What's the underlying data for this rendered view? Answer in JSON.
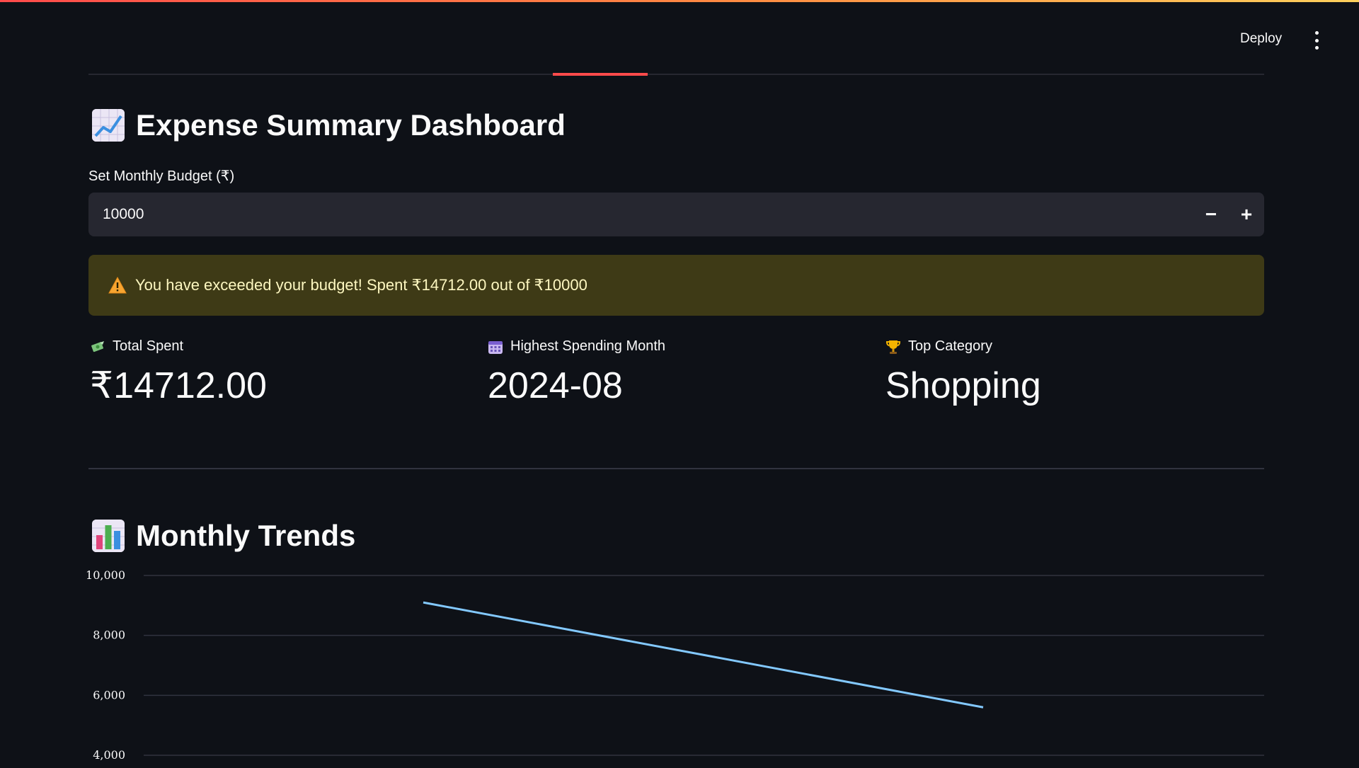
{
  "header": {
    "deploy_label": "Deploy"
  },
  "dashboard": {
    "title": "Expense Summary Dashboard",
    "budget_label": "Set Monthly Budget (₹)",
    "budget_value": "10000",
    "decrement_label": "−",
    "increment_label": "+",
    "alert_text": "You have exceeded your budget! Spent ₹14712.00 out of ₹10000",
    "metrics": [
      {
        "label": "Total Spent",
        "value": "₹14712.00",
        "icon": "money-icon"
      },
      {
        "label": "Highest Spending Month",
        "value": "2024-08",
        "icon": "calendar-icon"
      },
      {
        "label": "Top Category",
        "value": "Shopping",
        "icon": "trophy-icon"
      }
    ]
  },
  "trends": {
    "title": "Monthly Trends"
  },
  "colors": {
    "background": "#0e1117",
    "input_bg": "#262730",
    "alert_bg": "#3e3a16",
    "alert_text": "#fdf7c0",
    "accent": "#ff4b4b",
    "line": "#83c9ff"
  },
  "chart_data": {
    "type": "line",
    "y_ticks": [
      "10,000",
      "8,000",
      "6,000",
      "4,000"
    ],
    "y_tick_values": [
      10000,
      8000,
      6000,
      4000
    ],
    "series": [
      {
        "values": [
          9100,
          5600
        ]
      }
    ],
    "ylim": [
      4000,
      10000
    ],
    "grid": true
  }
}
